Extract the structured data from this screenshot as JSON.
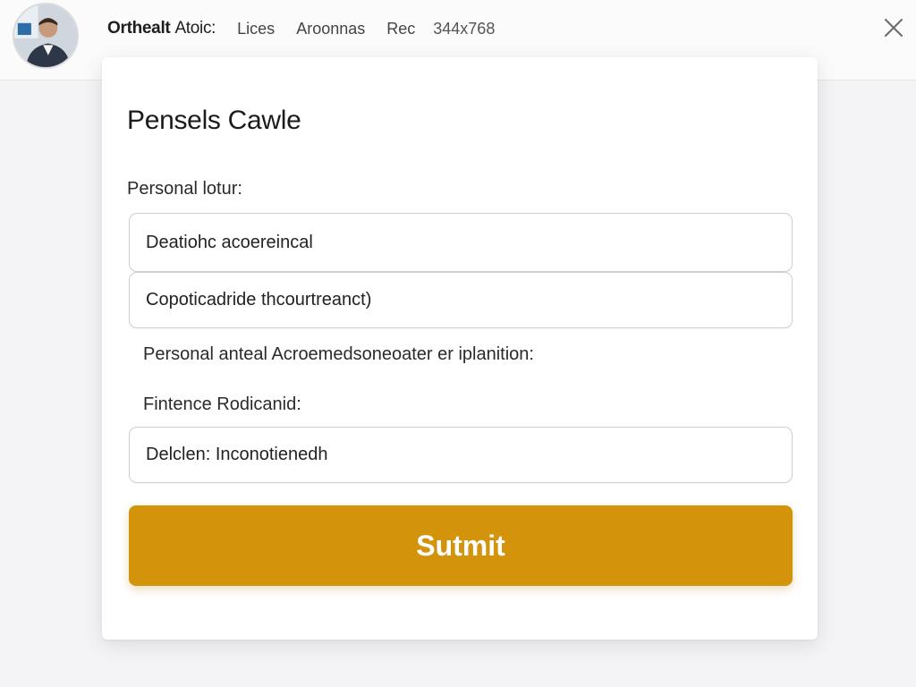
{
  "header": {
    "brand": "Orthealt",
    "brand_rest": "Atoic:",
    "nav_items": [
      "Lices",
      "Aroonnas",
      "Rec"
    ],
    "dimensions": "344x768",
    "close_icon": "close-icon",
    "avatar_icon": "user-avatar"
  },
  "form": {
    "title": "Pensels Cawle",
    "section_label": "Personal lotur:",
    "fields": [
      {
        "value": "Deatiohc acoereincal"
      },
      {
        "value": "Copoticadride thcourtreanct)"
      }
    ],
    "statement": "Personal anteal Acroemedsoneoater er iplanition:",
    "sub_label": "Fintence Rodicanid:",
    "field3": {
      "value": "Delclen: Inconotienedh"
    },
    "submit_label": "Sutmit"
  },
  "colors": {
    "accent": "#d3940c",
    "background": "#f4f4f6",
    "card": "#ffffff"
  }
}
